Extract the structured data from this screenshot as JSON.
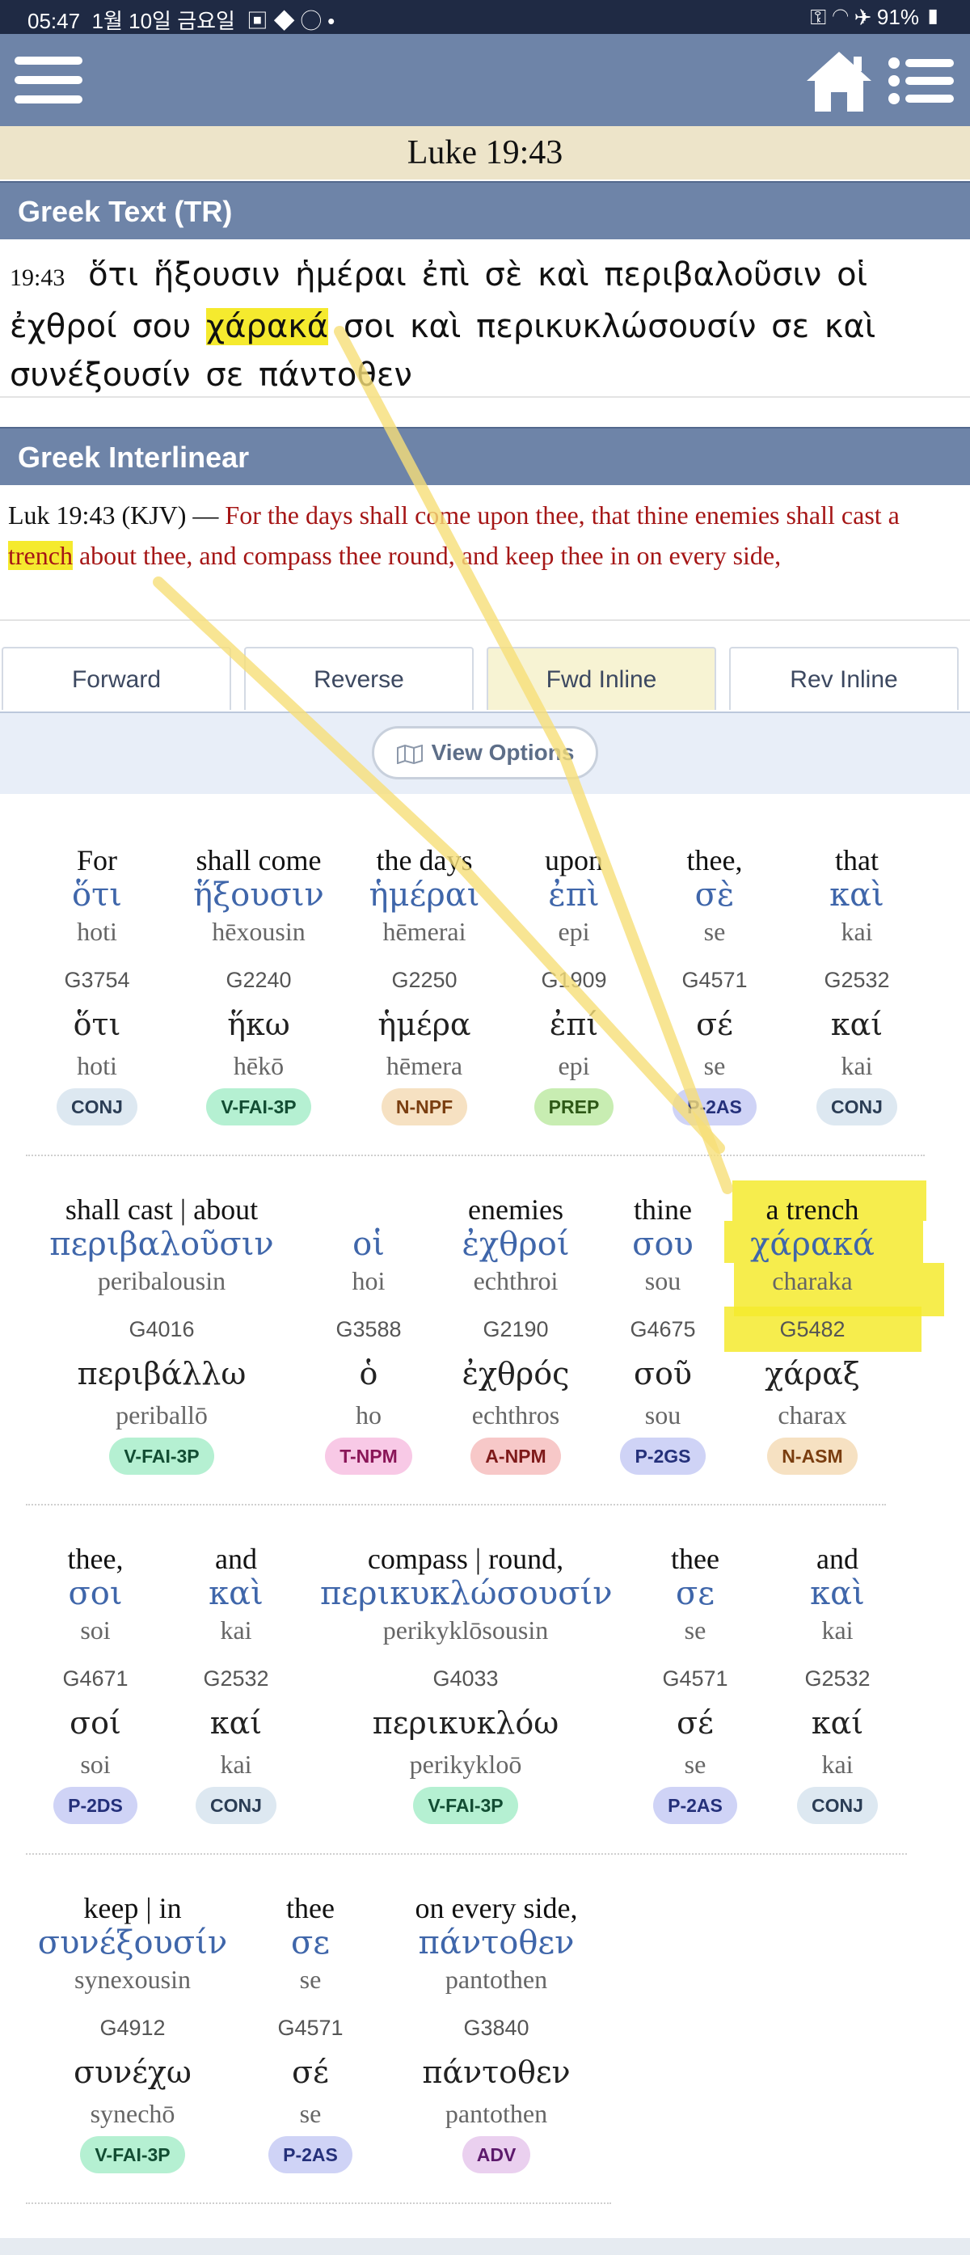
{
  "status_bar": {
    "time": "05:47",
    "date": "1월 10일 금요일",
    "battery": "91%"
  },
  "header": {
    "reference": "Luke 19:43"
  },
  "greek_text": {
    "title": "Greek Text (TR)",
    "verse_number": "19:43",
    "before": "ὅτι ἥξουσιν ἡμέραι ἐπὶ σὲ καὶ περιβαλοῦσιν οἱ ἐχθροί σου",
    "highlight": "χάρακά",
    "after": "σοι καὶ περικυκλώσουσίν σε καὶ συνέξουσίν σε πάντοθεν"
  },
  "interlinear": {
    "title": "Greek Interlinear",
    "kjv_ref": "Luk 19:43 (KJV) —",
    "kjv_before": "For the days shall come upon thee, that thine enemies shall cast a",
    "kjv_highlight": "trench",
    "kjv_after": "about thee, and compass thee round, and keep thee in on every side,"
  },
  "tabs": [
    {
      "label": "Forward",
      "active": false
    },
    {
      "label": "Reverse",
      "active": false
    },
    {
      "label": "Fwd Inline",
      "active": true
    },
    {
      "label": "Rev Inline",
      "active": false
    }
  ],
  "view_options_label": "View Options",
  "words": [
    {
      "en": "For",
      "gr": "ὅτι",
      "tr": "hoti",
      "strong": "G3754",
      "lex": "ὅτι",
      "lex_tr": "hoti",
      "pos": "CONJ"
    },
    {
      "en": "shall come",
      "gr": "ἥξουσιν",
      "tr": "hēxousin",
      "strong": "G2240",
      "lex": "ἥκω",
      "lex_tr": "hēkō",
      "pos": "V-FAI-3P"
    },
    {
      "en": "the days",
      "gr": "ἡμέραι",
      "tr": "hēmerai",
      "strong": "G2250",
      "lex": "ἡμέρα",
      "lex_tr": "hēmera",
      "pos": "N-NPF"
    },
    {
      "en": "upon",
      "gr": "ἐπὶ",
      "tr": "epi",
      "strong": "G1909",
      "lex": "ἐπί",
      "lex_tr": "epi",
      "pos": "PREP"
    },
    {
      "en": "thee,",
      "gr": "σὲ",
      "tr": "se",
      "strong": "G4571",
      "lex": "σέ",
      "lex_tr": "se",
      "pos": "P-2AS"
    },
    {
      "en": "that",
      "gr": "καὶ",
      "tr": "kai",
      "strong": "G2532",
      "lex": "καί",
      "lex_tr": "kai",
      "pos": "CONJ"
    },
    {
      "en": "shall cast | about",
      "gr": "περιβαλοῦσιν",
      "tr": "peribalousin",
      "strong": "G4016",
      "lex": "περιβάλλω",
      "lex_tr": "periballō",
      "pos": "V-FAI-3P"
    },
    {
      "en": "",
      "gr": "οἱ",
      "tr": "hoi",
      "strong": "G3588",
      "lex": "ὁ",
      "lex_tr": "ho",
      "pos": "T-NPM"
    },
    {
      "en": "enemies",
      "gr": "ἐχθροί",
      "tr": "echthroi",
      "strong": "G2190",
      "lex": "ἐχθρός",
      "lex_tr": "echthros",
      "pos": "A-NPM"
    },
    {
      "en": "thine",
      "gr": "σου",
      "tr": "sou",
      "strong": "G4675",
      "lex": "σοῦ",
      "lex_tr": "sou",
      "pos": "P-2GS"
    },
    {
      "en": "a trench",
      "gr": "χάρακά",
      "tr": "charaka",
      "strong": "G5482",
      "lex": "χάραξ",
      "lex_tr": "charax",
      "pos": "N-ASM"
    },
    {
      "en": "thee,",
      "gr": "σοι",
      "tr": "soi",
      "strong": "G4671",
      "lex": "σοί",
      "lex_tr": "soi",
      "pos": "P-2DS"
    },
    {
      "en": "and",
      "gr": "καὶ",
      "tr": "kai",
      "strong": "G2532",
      "lex": "καί",
      "lex_tr": "kai",
      "pos": "CONJ"
    },
    {
      "en": "compass | round,",
      "gr": "περικυκλώσουσίν",
      "tr": "perikyklōsousin",
      "strong": "G4033",
      "lex": "περικυκλόω",
      "lex_tr": "perikykloō",
      "pos": "V-FAI-3P"
    },
    {
      "en": "thee",
      "gr": "σε",
      "tr": "se",
      "strong": "G4571",
      "lex": "σέ",
      "lex_tr": "se",
      "pos": "P-2AS"
    },
    {
      "en": "and",
      "gr": "καὶ",
      "tr": "kai",
      "strong": "G2532",
      "lex": "καί",
      "lex_tr": "kai",
      "pos": "CONJ"
    },
    {
      "en": "keep | in",
      "gr": "συνέξουσίν",
      "tr": "synexousin",
      "strong": "G4912",
      "lex": "συνέχω",
      "lex_tr": "synechō",
      "pos": "V-FAI-3P"
    },
    {
      "en": "thee",
      "gr": "σε",
      "tr": "se",
      "strong": "G4571",
      "lex": "σέ",
      "lex_tr": "se",
      "pos": "P-2AS"
    },
    {
      "en": "on every side,",
      "gr": "πάντοθεν",
      "tr": "pantothen",
      "strong": "G3840",
      "lex": "πάντοθεν",
      "lex_tr": "pantothen",
      "pos": "ADV"
    }
  ]
}
